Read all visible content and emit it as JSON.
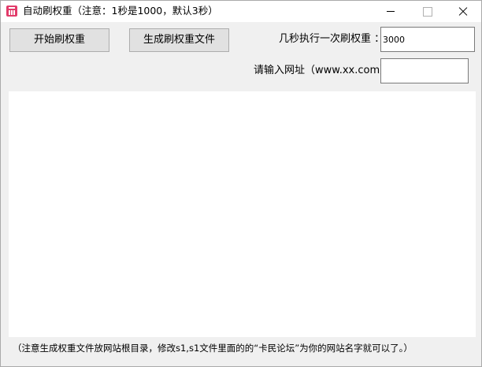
{
  "window": {
    "title": "自动刷权重（注意：1秒是1000，默认3秒）",
    "icon": "app-icon"
  },
  "toolbar": {
    "start_label": "开始刷权重",
    "generate_label": "生成刷权重文件"
  },
  "interval": {
    "label": "几秒执行一次刷权重 ：",
    "value": "3000"
  },
  "url": {
    "label": "请输入网址（www.xx.com）",
    "value": ""
  },
  "log": {
    "content": ""
  },
  "footer": {
    "note": "（注意生成权重文件放网站根目录，修改s1,s1文件里面的的“卡民论坛”为你的网站名字就可以了。）"
  }
}
